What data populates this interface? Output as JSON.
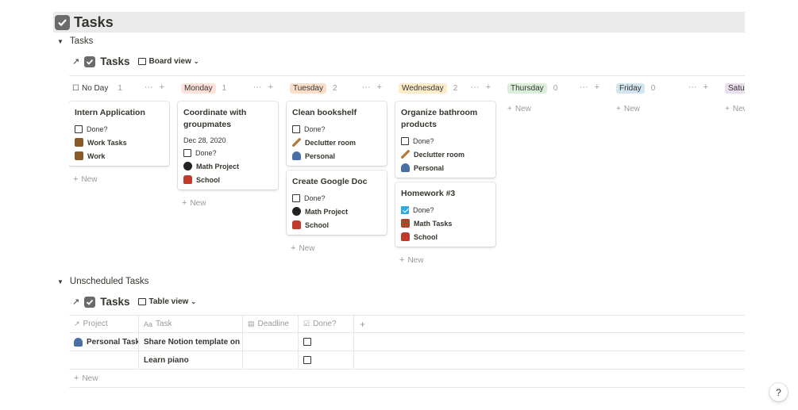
{
  "page": {
    "title": "Tasks"
  },
  "section1": {
    "toggle_label": "Tasks",
    "db_title": "Tasks",
    "view_label": "Board view"
  },
  "board": {
    "new_label": "New",
    "columns": [
      {
        "name": "No Day",
        "count": "1",
        "tag_color": "#ffffff",
        "cards": [
          {
            "title": "Intern Application",
            "date": "",
            "done": false,
            "done_label": "Done?",
            "rel1": "Work Tasks",
            "rel1_icon": "briefcase-icon",
            "rel2": "Work",
            "rel2_icon": "briefcase-icon"
          }
        ]
      },
      {
        "name": "Monday",
        "count": "1",
        "tag_color": "#ffe2dd",
        "cards": [
          {
            "title": "Coordinate with groupmates",
            "date": "Dec 28, 2020",
            "done": false,
            "done_label": "Done?",
            "rel1": "Math Project",
            "rel1_icon": "8-ball-icon",
            "rel2": "School",
            "rel2_icon": "backpack-icon"
          }
        ]
      },
      {
        "name": "Tuesday",
        "count": "2",
        "tag_color": "#fadec9",
        "cards": [
          {
            "title": "Clean bookshelf",
            "date": "",
            "done": false,
            "done_label": "Done?",
            "rel1": "Declutter room",
            "rel1_icon": "broom-icon",
            "rel2": "Personal",
            "rel2_icon": "person-icon"
          },
          {
            "title": "Create Google Doc",
            "date": "",
            "done": false,
            "done_label": "Done?",
            "rel1": "Math Project",
            "rel1_icon": "8-ball-icon",
            "rel2": "School",
            "rel2_icon": "backpack-icon"
          }
        ]
      },
      {
        "name": "Wednesday",
        "count": "2",
        "tag_color": "#fdecc8",
        "cards": [
          {
            "title": "Organize bathroom products",
            "date": "",
            "done": false,
            "done_label": "Done?",
            "rel1": "Declutter room",
            "rel1_icon": "broom-icon",
            "rel2": "Personal",
            "rel2_icon": "person-icon"
          },
          {
            "title": "Homework #3",
            "date": "",
            "done": true,
            "done_label": "Done?",
            "rel1": "Math Tasks",
            "rel1_icon": "abacus-icon",
            "rel2": "School",
            "rel2_icon": "backpack-icon"
          }
        ]
      },
      {
        "name": "Thursday",
        "count": "0",
        "tag_color": "#dbeddb",
        "cards": []
      },
      {
        "name": "Friday",
        "count": "0",
        "tag_color": "#d3e5ef",
        "cards": []
      },
      {
        "name": "Satur",
        "count": "",
        "tag_color": "#e8deee",
        "cards": []
      }
    ]
  },
  "section2": {
    "toggle_label": "Unscheduled Tasks",
    "db_title": "Tasks",
    "view_label": "Table view"
  },
  "table": {
    "headers": [
      {
        "label": "Project",
        "icon": "arrow-icon"
      },
      {
        "label": "Task",
        "icon": "text-icon"
      },
      {
        "label": "Deadline",
        "icon": "calendar-icon"
      },
      {
        "label": "Done?",
        "icon": "checkbox-icon"
      }
    ],
    "add_column": "+",
    "rows": [
      {
        "project": "Personal Tasks",
        "task": "Share Notion template on r",
        "deadline": "",
        "done": false
      },
      {
        "project": "",
        "task": "Learn piano",
        "deadline": "",
        "done": false
      }
    ],
    "new_label": "New"
  },
  "help": {
    "label": "?"
  }
}
